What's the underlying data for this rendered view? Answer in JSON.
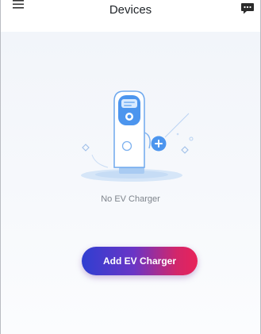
{
  "header": {
    "title": "Devices",
    "menu_icon": "hamburger-menu-icon",
    "chat_icon": "chat-bubble-icon"
  },
  "empty_state": {
    "illustration": "ev-charger-illustration",
    "message": "No EV Charger"
  },
  "primary_action": {
    "label": "Add EV Charger"
  },
  "colors": {
    "button_gradient_start": "#2f3fd1",
    "button_gradient_end": "#e8235a",
    "illustration_blue": "#4c95ee",
    "background": "#f4f7fb"
  }
}
